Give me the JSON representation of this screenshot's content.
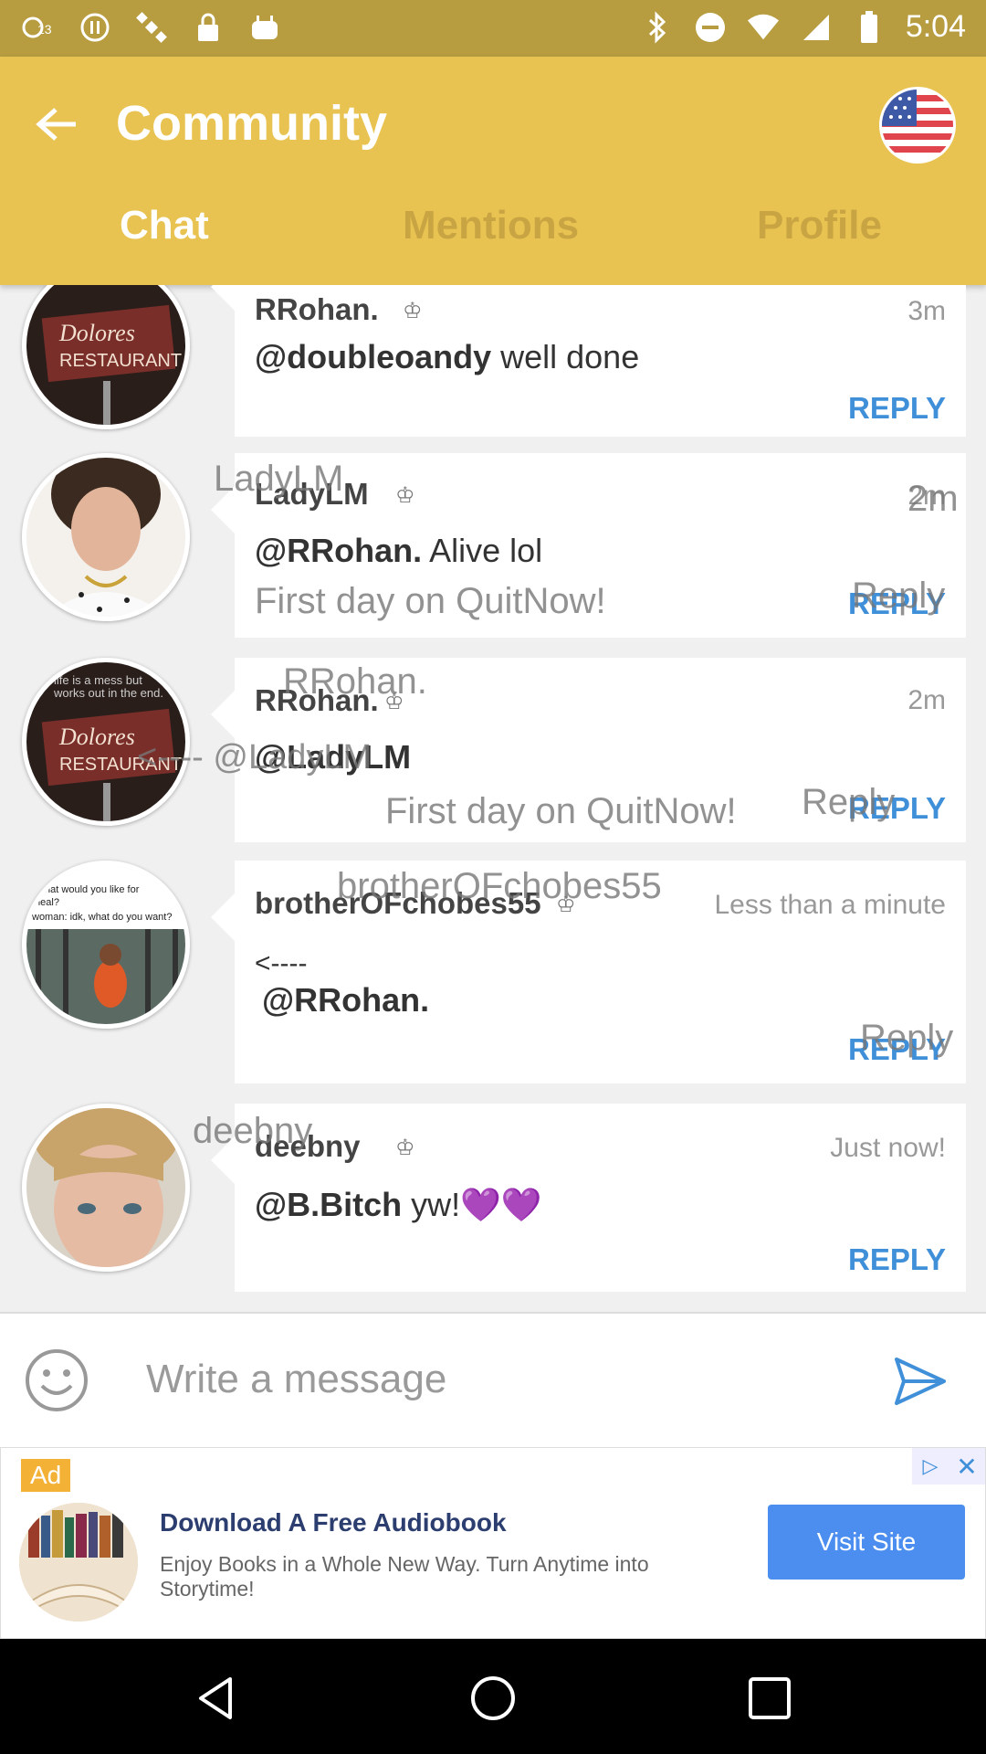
{
  "status_bar": {
    "time": "5:04"
  },
  "app_bar": {
    "title": "Community",
    "tabs": [
      {
        "label": "Chat",
        "active": true
      },
      {
        "label": "Mentions",
        "active": false
      },
      {
        "label": "Profile",
        "active": false
      }
    ]
  },
  "messages": [
    {
      "author": "RRohan.",
      "time": "3m",
      "mention": "@doubleoandy",
      "text": " well done",
      "reply": "REPLY"
    },
    {
      "author": "LadyLM",
      "time": "2m",
      "mention": "@RRohan.",
      "text": " Alive lol",
      "reply": "REPLY",
      "ghost_name": "LadyLM",
      "ghost_time": "2m",
      "ghost_text": "First day on QuitNow!",
      "ghost_reply": "Reply"
    },
    {
      "author": "RRohan.",
      "time": "2m",
      "mention": "@LadyLM",
      "text": "",
      "reply": "REPLY",
      "ghost_name": "RRohan.",
      "ghost_mention": "<---- @LadyLM",
      "ghost_text": "First day on QuitNow!",
      "ghost_reply": "Reply"
    },
    {
      "author": "brotherOFchobes55",
      "time": "Less than a minute",
      "line1": "<----",
      "mention": "@RRohan.",
      "reply": "REPLY",
      "ghost_name": "brotherOFchobes55",
      "ghost_reply": "Reply"
    },
    {
      "author": "deebny",
      "time": "Just now!",
      "mention": "@B.Bitch",
      "text": " yw!💜💜",
      "reply": "REPLY",
      "ghost_name": "deebny"
    }
  ],
  "composer": {
    "placeholder": "Write a message"
  },
  "ad": {
    "badge": "Ad",
    "title": "Download A Free Audiobook",
    "description": "Enjoy Books in a Whole New Way. Turn Anytime into Storytime!",
    "button": "Visit Site"
  },
  "colors": {
    "app_bar": "#e9c351",
    "status_bar": "#b79d40",
    "reply": "#3f8fd9",
    "tab_inactive": "#c9a443"
  }
}
